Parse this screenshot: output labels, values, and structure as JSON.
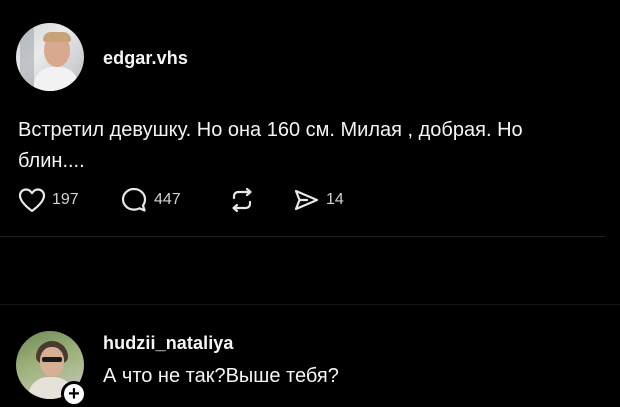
{
  "post": {
    "username": "edgar.vhs",
    "text_line1": "Встретил девушку. Но она 160 см. Милая , добрая. Но",
    "text_line2": "блин....",
    "likes": "197",
    "replies": "447",
    "shares": "14"
  },
  "comment": {
    "username": "hudzii_nataliya",
    "text": "А что не так?Выше тебя?",
    "follow_symbol": "+"
  },
  "icons": {
    "like": "heart-icon",
    "reply": "comment-bubble-icon",
    "repost": "repost-icon",
    "share": "send-icon"
  },
  "colors": {
    "background": "#000000",
    "text": "#f3f5f7",
    "counts": "#cfd1d4"
  }
}
